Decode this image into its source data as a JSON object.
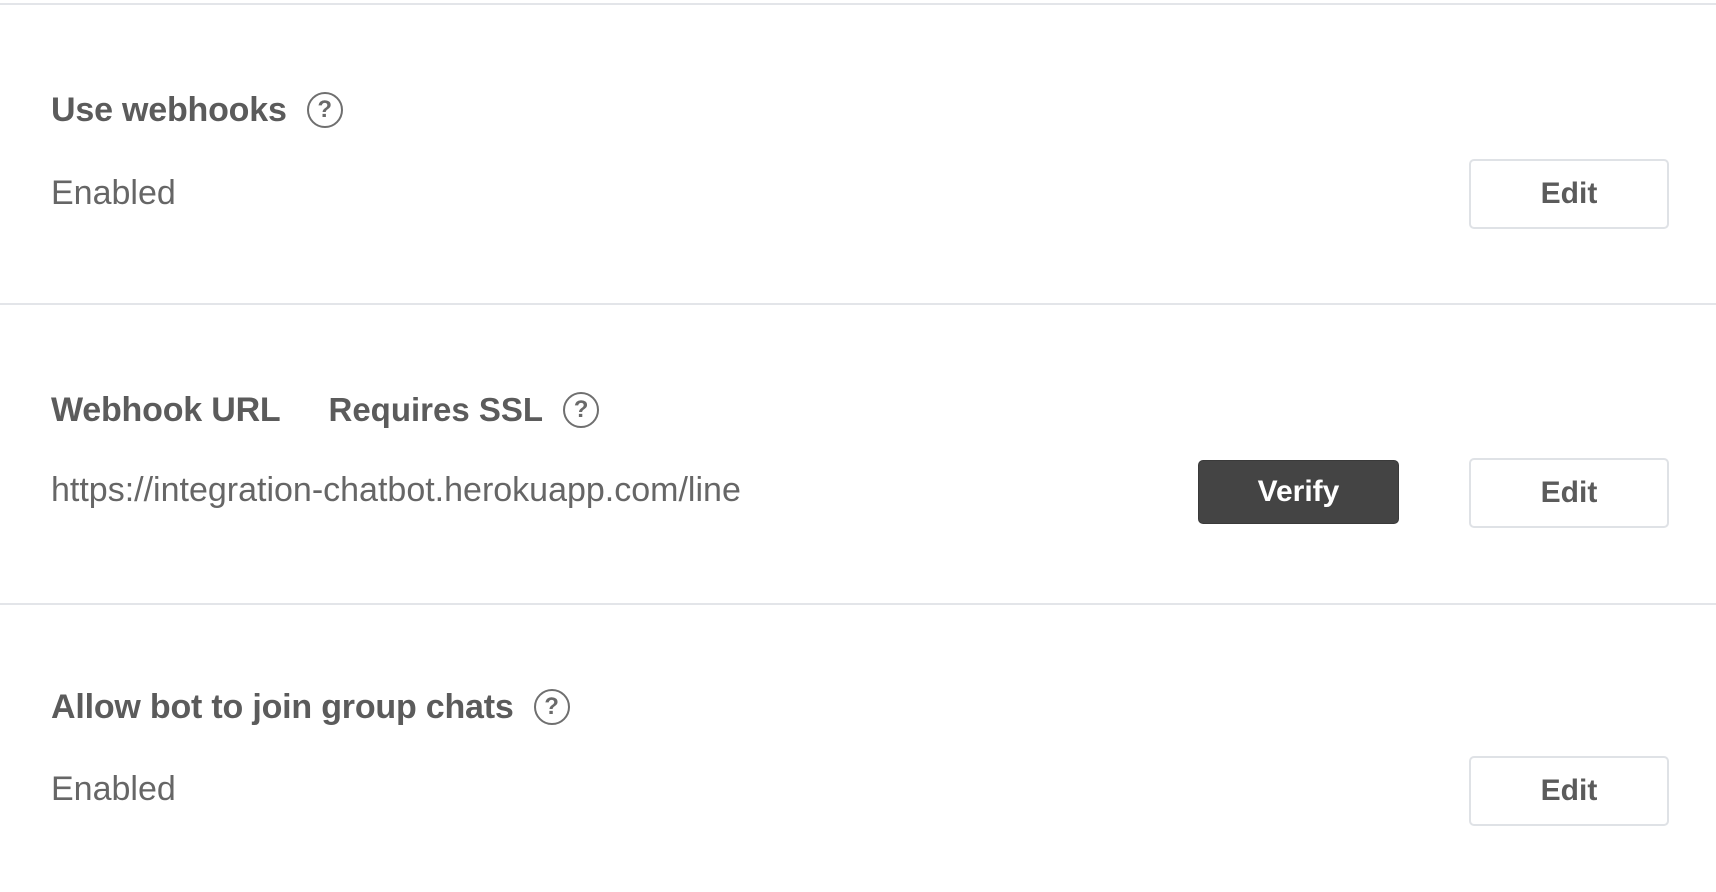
{
  "settings": [
    {
      "title": "Use webhooks",
      "help_icon": "question-circle-icon",
      "help_glyph": "?",
      "value": "Enabled",
      "edit_label": "Edit"
    },
    {
      "title": "Webhook URL",
      "subtitle": "Requires SSL",
      "help_icon": "question-circle-icon",
      "help_glyph": "?",
      "value": "https://integration-chatbot.herokuapp.com/line",
      "verify_label": "Verify",
      "edit_label": "Edit"
    },
    {
      "title": "Allow bot to join group chats",
      "help_icon": "question-circle-icon",
      "help_glyph": "?",
      "value": "Enabled",
      "edit_label": "Edit"
    }
  ],
  "colors": {
    "text": "#5b5b5b",
    "divider": "#e3e5e9",
    "verify_bg": "#444444",
    "verify_text": "#ffffff",
    "edit_border": "#dfe2e6"
  }
}
